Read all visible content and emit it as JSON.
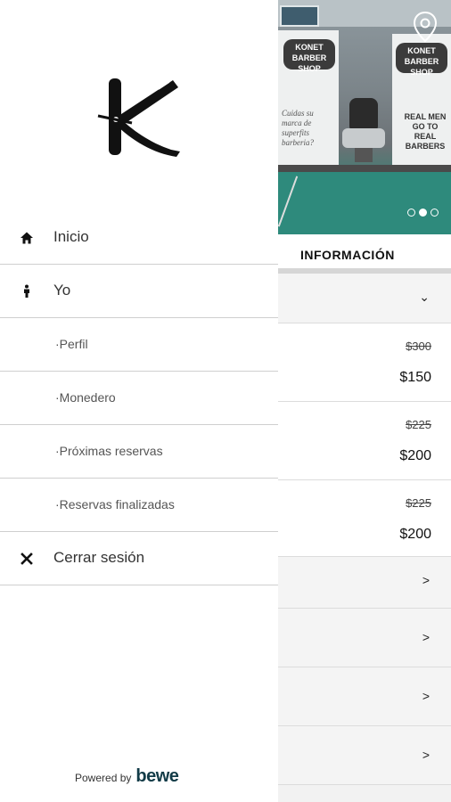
{
  "drawer": {
    "menu": [
      {
        "id": "inicio",
        "label": "Inicio",
        "icon": "home-icon"
      },
      {
        "id": "yo",
        "label": "Yo",
        "icon": "person-icon"
      },
      {
        "id": "perfil",
        "label": "·Perfil",
        "icon": ""
      },
      {
        "id": "monedero",
        "label": "·Monedero",
        "icon": ""
      },
      {
        "id": "proximas",
        "label": "·Próximas reservas",
        "icon": ""
      },
      {
        "id": "finalizadas",
        "label": "·Reservas finalizadas",
        "icon": ""
      },
      {
        "id": "cerrar",
        "label": "Cerrar sesión",
        "icon": "close-icon"
      }
    ],
    "powered_by": "Powered by",
    "brand": "bewe"
  },
  "hero": {
    "shop_name_line1": "KONET",
    "shop_name_line2": "BARBER SHOP",
    "banner_left_text": "Cuidas su marca de superfits barberia?",
    "banner_right_text": "REAL MEN GO TO REAL BARBERS",
    "carousel_dots": 3,
    "carousel_active": 1
  },
  "info": {
    "title": "INFORMACIÓN",
    "chevron_down": "⌄",
    "services": [
      {
        "old_price": "$300",
        "new_price": "$150"
      },
      {
        "old_price": "$225",
        "new_price": "$200"
      },
      {
        "old_price": "$225",
        "new_price": "$200"
      }
    ],
    "more_rows": [
      ">",
      ">",
      ">",
      ">"
    ]
  },
  "colors": {
    "accent": "#123b47",
    "table_green": "#2e8a7c",
    "divider": "#cfcfcf"
  }
}
